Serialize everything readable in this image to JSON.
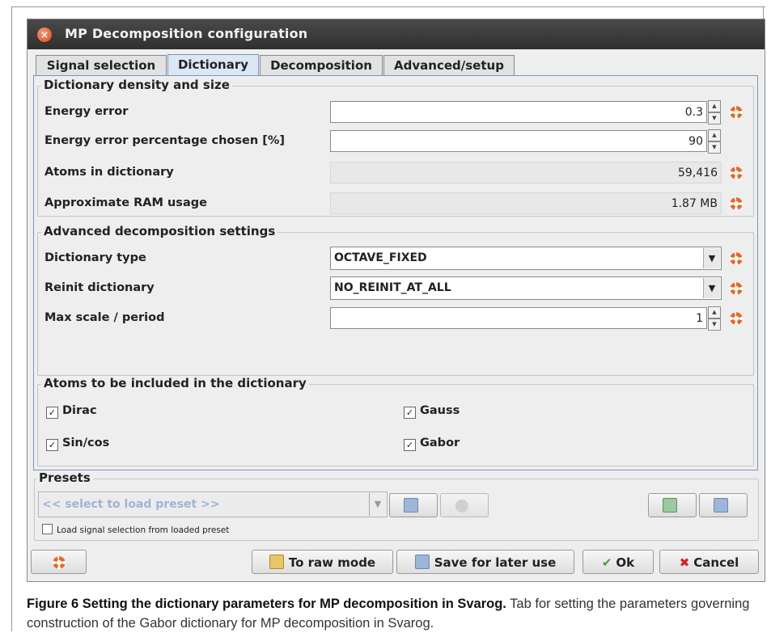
{
  "window": {
    "title": "MP Decomposition configuration"
  },
  "tabs": [
    {
      "label": "Signal selection"
    },
    {
      "label": "Dictionary"
    },
    {
      "label": "Decomposition"
    },
    {
      "label": "Advanced/setup"
    }
  ],
  "density": {
    "title": "Dictionary density and size",
    "energy_error": {
      "label": "Energy error",
      "value": "0.3"
    },
    "energy_pct": {
      "label": "Energy error percentage chosen [%]",
      "value": "90"
    },
    "atoms": {
      "label": "Atoms in dictionary",
      "value": "59,416"
    },
    "ram": {
      "label": "Approximate RAM usage",
      "value": "1.87 MB"
    }
  },
  "advanced": {
    "title": "Advanced decomposition settings",
    "dict_type": {
      "label": "Dictionary type",
      "value": "OCTAVE_FIXED"
    },
    "reinit": {
      "label": "Reinit dictionary",
      "value": "NO_REINIT_AT_ALL"
    },
    "max_scale": {
      "label": "Max scale / period",
      "value": "1"
    }
  },
  "atoms_group": {
    "title": "Atoms to be included in the dictionary",
    "dirac": "Dirac",
    "gauss": "Gauss",
    "sincos": "Sin/cos",
    "gabor": "Gabor"
  },
  "presets": {
    "title": "Presets",
    "placeholder": "<< select to load preset >>",
    "load_signal_label": "Load signal selection from loaded preset"
  },
  "buttons": {
    "raw_mode": "To raw mode",
    "save_later": "Save for later use",
    "ok": "Ok",
    "cancel": "Cancel"
  },
  "caption": {
    "bold": "Figure 6 Setting the dictionary parameters for MP decomposition in Svarog.",
    "text": " Tab for setting the parameters governing construction of the Gabor dictionary for MP decomposition in Svarog."
  },
  "colors": {
    "title_bar": "#3a3a3a",
    "tab_active": "#dce7f5",
    "help_icon": "#e8672a",
    "ok_check": "#3aa33a",
    "cancel_x": "#d42020"
  }
}
